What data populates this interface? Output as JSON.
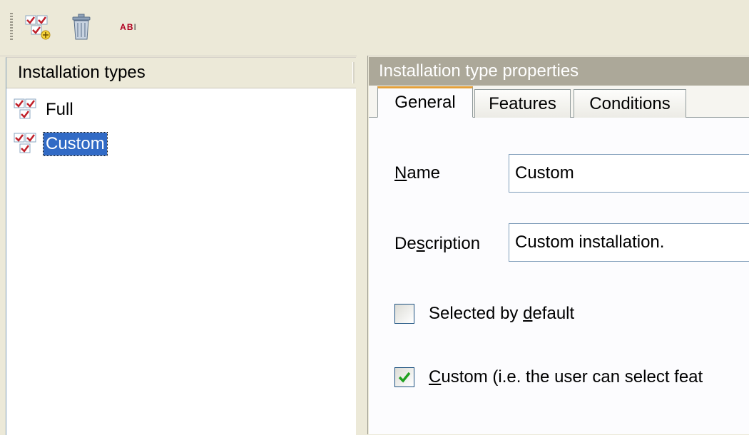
{
  "toolbar": {
    "buttons": [
      {
        "name": "add-installation-type",
        "icon": "installation-type-add-icon"
      },
      {
        "name": "delete",
        "icon": "trash-icon"
      },
      {
        "name": "rename",
        "icon": "rename-icon",
        "text": "AB",
        "cursor_glyph": "I"
      }
    ]
  },
  "left_panel": {
    "header": "Installation types",
    "items": [
      {
        "label": "Full",
        "icon": "installation-type-icon",
        "selected": false
      },
      {
        "label": "Custom",
        "icon": "installation-type-icon",
        "selected": true
      }
    ]
  },
  "right_panel": {
    "header": "Installation type properties",
    "tabs": [
      {
        "label": "General",
        "active": true
      },
      {
        "label": "Features",
        "active": false
      },
      {
        "label": "Conditions",
        "active": false
      }
    ],
    "fields": {
      "name": {
        "label_prefix": "",
        "label_accel": "N",
        "label_suffix": "ame",
        "value": "Custom"
      },
      "description": {
        "label_prefix": "De",
        "label_accel": "s",
        "label_suffix": "cription",
        "value": "Custom installation."
      }
    },
    "checkboxes": {
      "selected_by_default": {
        "label_prefix": "Selected by ",
        "label_accel": "d",
        "label_suffix": "efault",
        "checked": false
      },
      "custom": {
        "label_prefix": "",
        "label_accel": "C",
        "label_suffix": "ustom (i.e. the user can select feat",
        "checked": true
      }
    }
  },
  "colors": {
    "selection": "#316ac5",
    "header_bg": "#aca899",
    "tab_accent": "#e3a03b",
    "check_mark": "#21a121"
  }
}
